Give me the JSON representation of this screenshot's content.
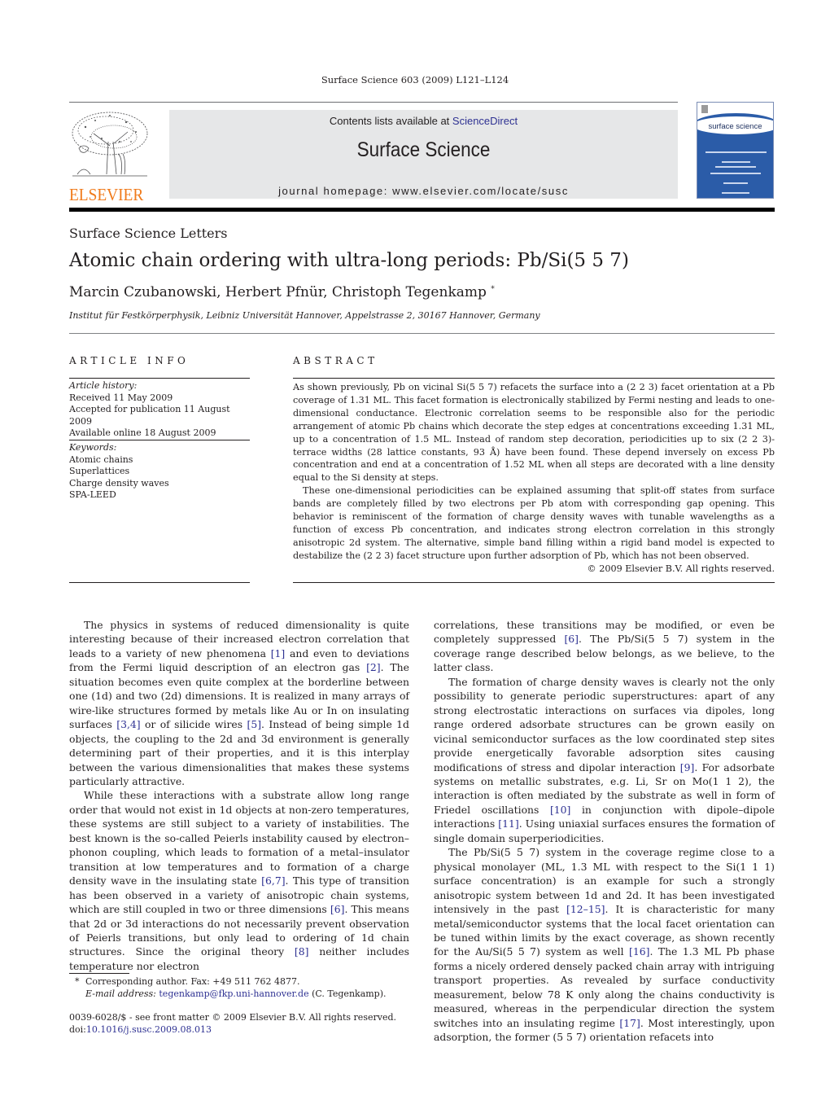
{
  "citation": "Surface Science 603 (2009) L121–L124",
  "masthead": {
    "contents_prefix": "Contents lists available at ",
    "contents_link": "ScienceDirect",
    "journal_title": "Surface Science",
    "homepage": "journal homepage: www.elsevier.com/locate/susc"
  },
  "publisher": {
    "wordmark": "ELSEVIER",
    "color": "#f07a1a"
  },
  "cover": {
    "title": "surface science",
    "color": "#2b5ca8"
  },
  "section_label": "Surface Science Letters",
  "article_title": "Atomic chain ordering with ultra-long periods: Pb/Si(5 5 7)",
  "authors": "Marcin Czubanowski, Herbert Pfnür, Christoph Tegenkamp",
  "author_mark": "*",
  "affiliation": "Institut für Festkörperphysik, Leibniz Universität Hannover, Appelstrasse 2, 30167 Hannover, Germany",
  "article_info": {
    "heading": "ARTICLE INFO",
    "history_label": "Article history:",
    "history": [
      "Received 11 May 2009",
      "Accepted for publication 11 August 2009",
      "Available online 18 August 2009"
    ],
    "keywords_label": "Keywords:",
    "keywords": [
      "Atomic chains",
      "Superlattices",
      "Charge density waves",
      "SPA-LEED"
    ]
  },
  "abstract": {
    "heading": "ABSTRACT",
    "paragraphs": [
      "As shown previously, Pb on vicinal Si(5 5 7) refacets the surface into a (2 2 3) facet orientation at a Pb coverage of 1.31 ML. This facet formation is electronically stabilized by Fermi nesting and leads to one-dimensional conductance. Electronic correlation seems to be responsible also for the periodic arrangement of atomic Pb chains which decorate the step edges at concentrations exceeding 1.31 ML, up to a concentration of 1.5 ML. Instead of random step decoration, periodicities up to six (2 2 3)-terrace widths (28 lattice constants, 93 Å) have been found. These depend inversely on excess Pb concentration and end at a concentration of 1.52 ML when all steps are decorated with a line density equal to the Si density at steps.",
      "These one-dimensional periodicities can be explained assuming that split-off states from surface bands are completely filled by two electrons per Pb atom with corresponding gap opening. This behavior is reminiscent of the formation of charge density waves with tunable wavelengths as a function of excess Pb concentration, and indicates strong electron correlation in this strongly anisotropic 2d system. The alternative, simple band filling within a rigid band model is expected to destabilize the (2 2 3) facet structure upon further adsorption of Pb, which has not been observed."
    ],
    "copyright": "© 2009 Elsevier B.V. All rights reserved."
  },
  "body": {
    "left": [
      [
        {
          "t": "The physics in systems of reduced dimensionality is quite interesting because of their increased electron correlation that leads to a variety of new phenomena "
        },
        {
          "ref": "[1]"
        },
        {
          "t": " and even to deviations from the Fermi liquid description of an electron gas "
        },
        {
          "ref": "[2]"
        },
        {
          "t": ". The situation becomes even quite complex at the borderline between one (1d) and two (2d) dimensions. It is realized in many arrays of wire-like structures formed by metals like Au or In on insulating surfaces "
        },
        {
          "ref": "[3,4]"
        },
        {
          "t": " or of silicide wires "
        },
        {
          "ref": "[5]"
        },
        {
          "t": ". Instead of being simple 1d objects, the coupling to the 2d and 3d environment is generally determining part of their properties, and it is this interplay between the various dimensionalities that makes these systems particularly attractive."
        }
      ],
      [
        {
          "t": "While these interactions with a substrate allow long range order that would not exist in 1d objects at non-zero temperatures, these systems are still subject to a variety of instabilities. The best known is the so-called Peierls instability caused by electron–phonon coupling, which leads to formation of a metal–insulator transition at low temperatures and to formation of a charge density wave in the insulating state "
        },
        {
          "ref": "[6,7]"
        },
        {
          "t": ". This type of transition has been observed in a variety of anisotropic chain systems, which are still coupled in two or three dimensions "
        },
        {
          "ref": "[6]"
        },
        {
          "t": ". This means that 2d or 3d interactions do not necessarily prevent observation of Peierls transitions, but only lead to ordering of 1d chain structures. Since the original theory "
        },
        {
          "ref": "[8]"
        },
        {
          "t": " neither includes temperature nor electron"
        }
      ]
    ],
    "right": [
      [
        {
          "t": "correlations, these transitions may be modified, or even be completely suppressed "
        },
        {
          "ref": "[6]"
        },
        {
          "t": ". The Pb/Si(5 5 7) system in the coverage range described below belongs, as we believe, to the latter class."
        }
      ],
      [
        {
          "t": "The formation of charge density waves is clearly not the only possibility to generate periodic superstructures: apart of any strong electrostatic interactions on surfaces via dipoles, long range ordered adsorbate structures can be grown easily on vicinal semiconductor surfaces as the low coordinated step sites provide energetically favorable adsorption sites causing modifications of stress and dipolar interaction "
        },
        {
          "ref": "[9]"
        },
        {
          "t": ". For adsorbate systems on metallic substrates, e.g. Li, Sr on Mo(1 1 2), the interaction is often mediated by the substrate as well in form of Friedel oscillations "
        },
        {
          "ref": "[10]"
        },
        {
          "t": " in conjunction with dipole–dipole interactions "
        },
        {
          "ref": "[11]"
        },
        {
          "t": ". Using uniaxial surfaces ensures the formation of single domain superperiodicities."
        }
      ],
      [
        {
          "t": "The Pb/Si(5 5 7) system in the coverage regime close to a physical monolayer (ML, 1.3 ML with respect to the Si(1 1 1) surface concentration) is an example for such a strongly anisotropic system between 1d and 2d. It has been investigated intensively in the past "
        },
        {
          "ref": "[12–15]"
        },
        {
          "t": ". It is characteristic for many metal/semiconductor systems that the local facet orientation can be tuned within limits by the exact coverage, as shown recently for the Au/Si(5 5 7) system as well "
        },
        {
          "ref": "[16]"
        },
        {
          "t": ". The 1.3 ML Pb phase forms a nicely ordered densely packed chain array with intriguing transport properties. As revealed by surface conductivity measurement, below 78 K only along the chains conductivity is measured, whereas in the perpendicular direction the system switches into an insulating regime "
        },
        {
          "ref": "[17]"
        },
        {
          "t": ". Most interestingly, upon adsorption, the former (5 5 7) orientation refacets into"
        }
      ]
    ]
  },
  "footnote": {
    "mark": "*",
    "text": "Corresponding author. Fax: +49 511 762 4877.",
    "email_label": "E-mail address:",
    "email": "tegenkamp@fkp.uni-hannover.de",
    "email_suffix": " (C. Tegenkamp)."
  },
  "front_matter": {
    "line1": "0039-6028/$ - see front matter © 2009 Elsevier B.V. All rights reserved.",
    "doi_prefix": "doi:",
    "doi": "10.1016/j.susc.2009.08.013"
  }
}
